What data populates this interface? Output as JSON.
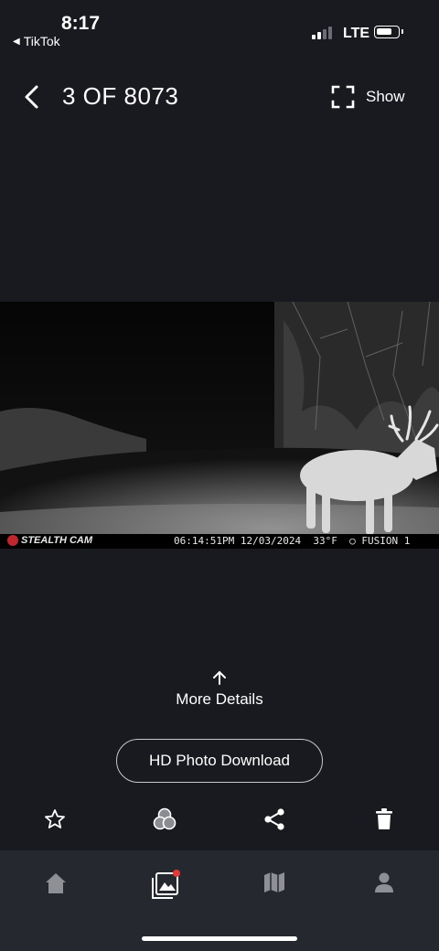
{
  "status_bar": {
    "time": "8:17",
    "back_app": "TikTok",
    "network": "LTE"
  },
  "header": {
    "counter": "3 OF 8073",
    "show_label": "Show"
  },
  "photo": {
    "brand": "STEALTH CAM",
    "stamp_time": "06:14:51PM",
    "stamp_date": "12/03/2024",
    "stamp_temp": "33°F",
    "stamp_camera": "FUSION 1"
  },
  "details": {
    "more_label": "More Details",
    "hd_download_label": "HD Photo Download"
  },
  "actions": [
    "star-icon",
    "filter-circles-icon",
    "share-icon",
    "trash-icon"
  ],
  "nav": {
    "items": [
      "home-icon",
      "gallery-icon",
      "map-icon",
      "profile-icon"
    ],
    "active": "gallery-icon",
    "badge_color": "#e53935"
  }
}
